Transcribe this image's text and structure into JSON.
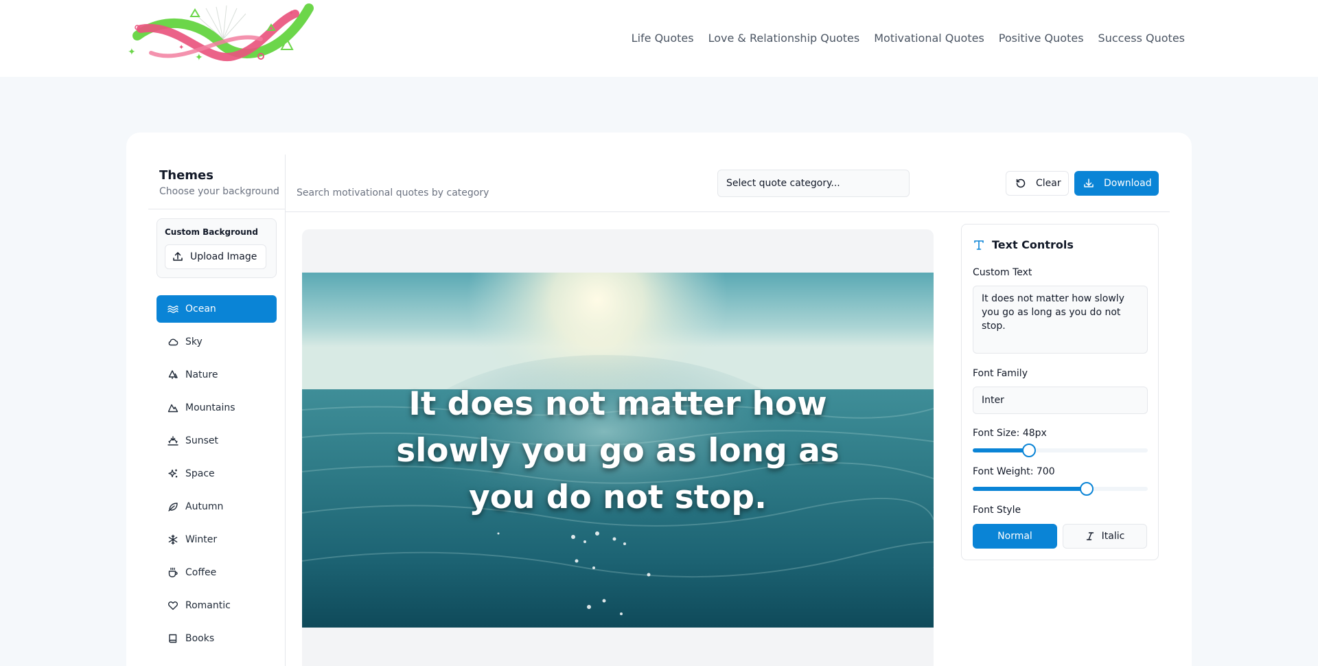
{
  "nav": {
    "items": [
      "Life Quotes",
      "Love & Relationship Quotes",
      "Motivational Quotes",
      "Positive Quotes",
      "Success Quotes"
    ]
  },
  "sidebar": {
    "title": "Themes",
    "subtitle": "Choose your background",
    "custom_bg_title": "Custom Background",
    "upload_label": "Upload Image",
    "themes": [
      {
        "label": "Ocean",
        "icon": "waves-icon",
        "active": true
      },
      {
        "label": "Sky",
        "icon": "cloud-icon"
      },
      {
        "label": "Nature",
        "icon": "tree-icon"
      },
      {
        "label": "Mountains",
        "icon": "mountain-icon"
      },
      {
        "label": "Sunset",
        "icon": "sunset-icon"
      },
      {
        "label": "Space",
        "icon": "sparkles-icon"
      },
      {
        "label": "Autumn",
        "icon": "leaf-icon"
      },
      {
        "label": "Winter",
        "icon": "snowflake-icon"
      },
      {
        "label": "Coffee",
        "icon": "coffee-icon"
      },
      {
        "label": "Romantic",
        "icon": "heart-icon"
      },
      {
        "label": "Books",
        "icon": "book-icon"
      }
    ]
  },
  "toolbar": {
    "search_hint": "Search motivational quotes by category",
    "category_placeholder": "Select quote category...",
    "clear_label": "Clear",
    "download_label": "Download"
  },
  "preview": {
    "quote": "It does not matter how slowly you go as long as you do not stop."
  },
  "controls": {
    "title": "Text Controls",
    "custom_text_label": "Custom Text",
    "custom_text_value": "It does not matter how slowly you go as long as you do not stop.",
    "font_family_label": "Font Family",
    "font_family_value": "Inter",
    "font_size_label": "Font Size: 48px",
    "font_size_fraction": 0.32,
    "font_weight_label": "Font Weight: 700",
    "font_weight_fraction": 0.65,
    "font_style_label": "Font Style",
    "normal_label": "Normal",
    "italic_label": "Italic"
  },
  "colors": {
    "accent": "#0a84d6",
    "logo_pink": "#e9557e",
    "logo_green": "#6cd64a"
  }
}
